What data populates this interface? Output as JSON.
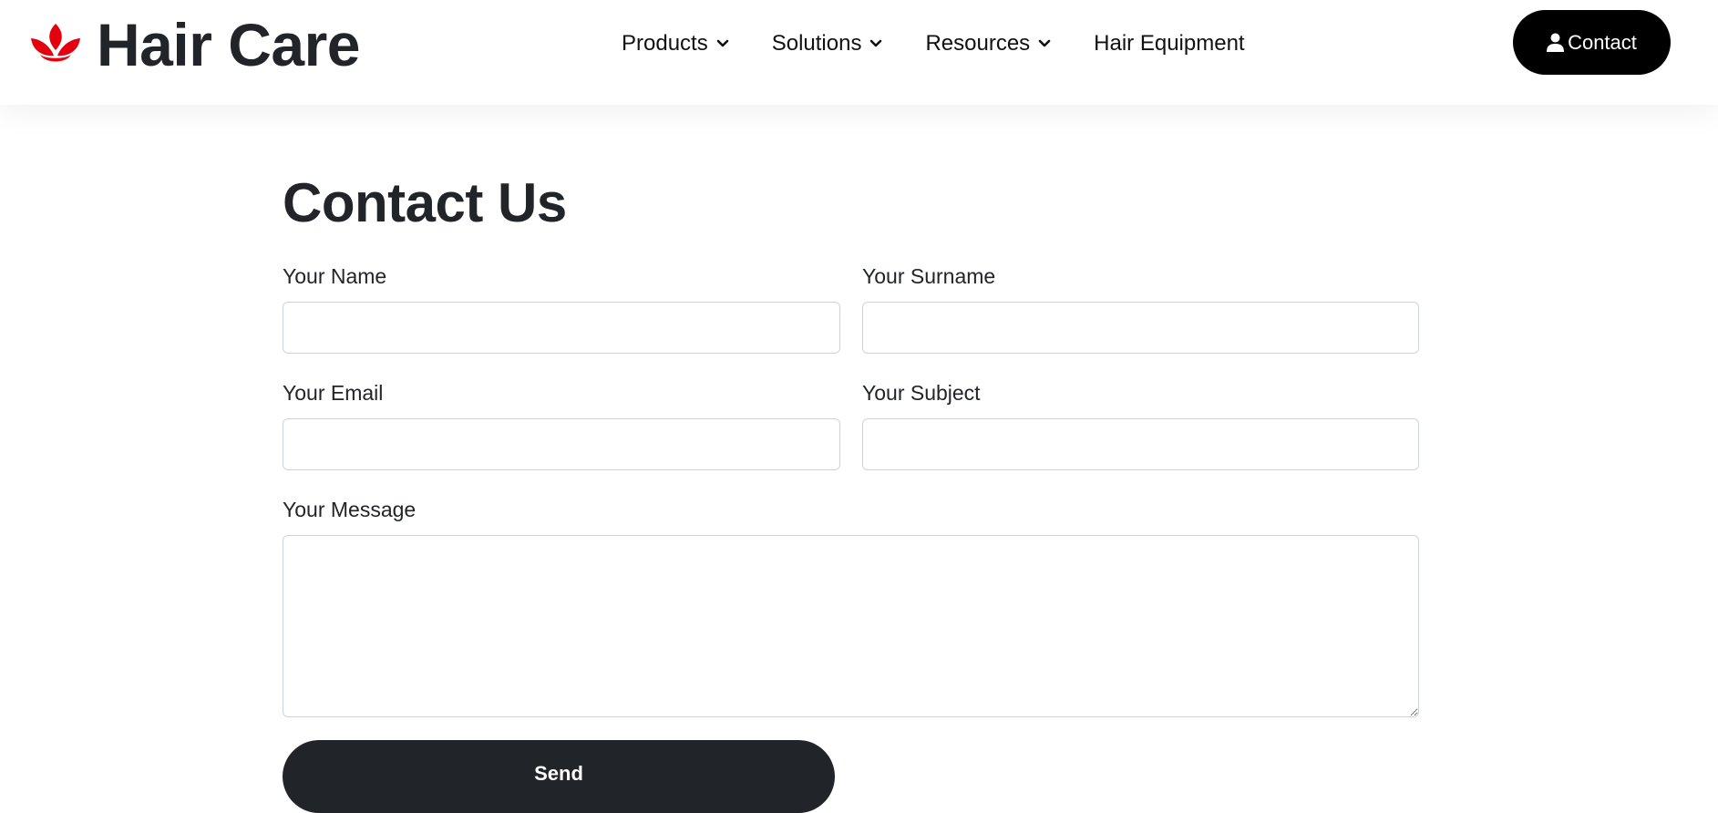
{
  "header": {
    "brand": "Hair Care",
    "nav": [
      {
        "label": "Products",
        "has_dropdown": true
      },
      {
        "label": "Solutions",
        "has_dropdown": true
      },
      {
        "label": "Resources",
        "has_dropdown": true
      },
      {
        "label": "Hair Equipment",
        "has_dropdown": false
      }
    ],
    "contact_label": "Contact"
  },
  "form": {
    "title": "Contact Us",
    "name_label": "Your Name",
    "surname_label": "Your Surname",
    "email_label": "Your Email",
    "subject_label": "Your Subject",
    "message_label": "Your Message",
    "send_label": "Send"
  },
  "colors": {
    "brand_red": "#e3000f",
    "dark": "#212529",
    "black": "#000000",
    "border": "#ced4da"
  },
  "icons": [
    "lotus-logo-icon",
    "chevron-down-icon",
    "user-icon"
  ]
}
